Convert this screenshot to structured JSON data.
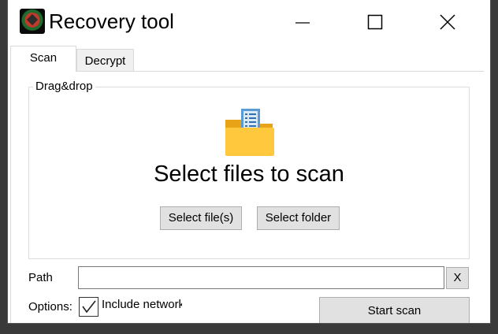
{
  "window": {
    "title": "Recovery tool",
    "app_icon": "recovery-tool-app-icon"
  },
  "caption_buttons": {
    "minimize_icon": "minimize-icon",
    "maximize_icon": "maximize-icon",
    "close_icon": "close-icon"
  },
  "tabs": [
    {
      "label": "Scan",
      "active": true
    },
    {
      "label": "Decrypt",
      "active": false
    }
  ],
  "scan": {
    "group_label": "Drag&drop",
    "folder_icon": "folder-documents-icon",
    "headline": "Select files to scan",
    "select_files_label": "Select file(s)",
    "select_folder_label": "Select folder",
    "path_label": "Path",
    "path_value": "",
    "clear_label": "X",
    "options_label": "Options:",
    "include_network_label": "Include network",
    "include_network_checked": true,
    "start_scan_label": "Start scan"
  },
  "colors": {
    "folder": "#ffc83d",
    "folder_back": "#e8a317",
    "document": "#5b9bd5"
  }
}
